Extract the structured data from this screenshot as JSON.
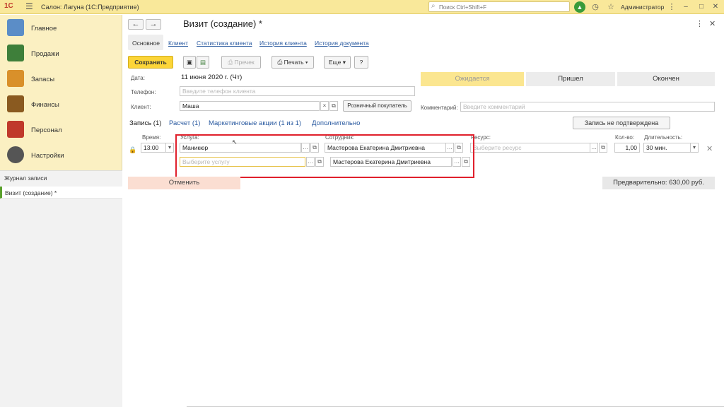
{
  "titlebar": {
    "logo": "1С",
    "app_title": "Салон: Лагуна  (1С:Предприятие)",
    "search_placeholder": "Поиск Ctrl+Shift+F",
    "user": "Администратор"
  },
  "sidebar": {
    "items": [
      {
        "label": "Главное",
        "color": "#5b8dc7"
      },
      {
        "label": "Продажи",
        "color": "#3e7f3a"
      },
      {
        "label": "Запасы",
        "color": "#d9902a"
      },
      {
        "label": "Финансы",
        "color": "#8a5a20"
      },
      {
        "label": "Персонал",
        "color": "#c0392b"
      },
      {
        "label": "Настройки",
        "color": "#555555"
      }
    ],
    "journal_header": "Журнал записи",
    "journal_item": "Визит (создание) *"
  },
  "form": {
    "title": "Визит (создание) *",
    "tabs": [
      "Основное",
      "Клиент",
      "Статистика клиента",
      "История клиента",
      "История документа"
    ],
    "toolbar": {
      "save": "Сохранить",
      "receipt": "Пречек",
      "print": "Печать",
      "more": "Еще",
      "help": "?"
    },
    "date_label": "Дата:",
    "date_value": "11 июня 2020 г. (Чт)",
    "phone_label": "Телефон:",
    "phone_placeholder": "Введите телефон клиента",
    "client_label": "Клиент:",
    "client_value": "Маша",
    "retail_button": "Розничный покупатель",
    "statuses": [
      "Ожидается",
      "Пришел",
      "Окончен"
    ],
    "comment_label": "Комментарий:",
    "comment_placeholder": "Введите комментарий",
    "subtabs": [
      "Запись (1)",
      "Расчет (1)",
      "Маркетинговые акции (1 из 1)",
      "Дополнительно"
    ],
    "unconfirmed_button": "Запись не подтверждена",
    "record": {
      "time_label": "Время:",
      "time_value": "13:00",
      "service_label": "Услуга:",
      "service_value": "Маникюр",
      "service_placeholder": "Выберите услугу",
      "employee_label": "Сотрудник:",
      "employee_value": "Мастерова Екатерина Дмитриевна",
      "employee_value2": "Мастерова Екатерина Дмитриевна",
      "resource_label": "Ресурс:",
      "resource_placeholder": "Выберите ресурс",
      "qty_label": "Кол-во:",
      "qty_value": "1,00",
      "duration_label": "Длительность:",
      "duration_value": "30 мин."
    },
    "cancel": "Отменить",
    "total": "Предварительно: 630,00 руб."
  }
}
